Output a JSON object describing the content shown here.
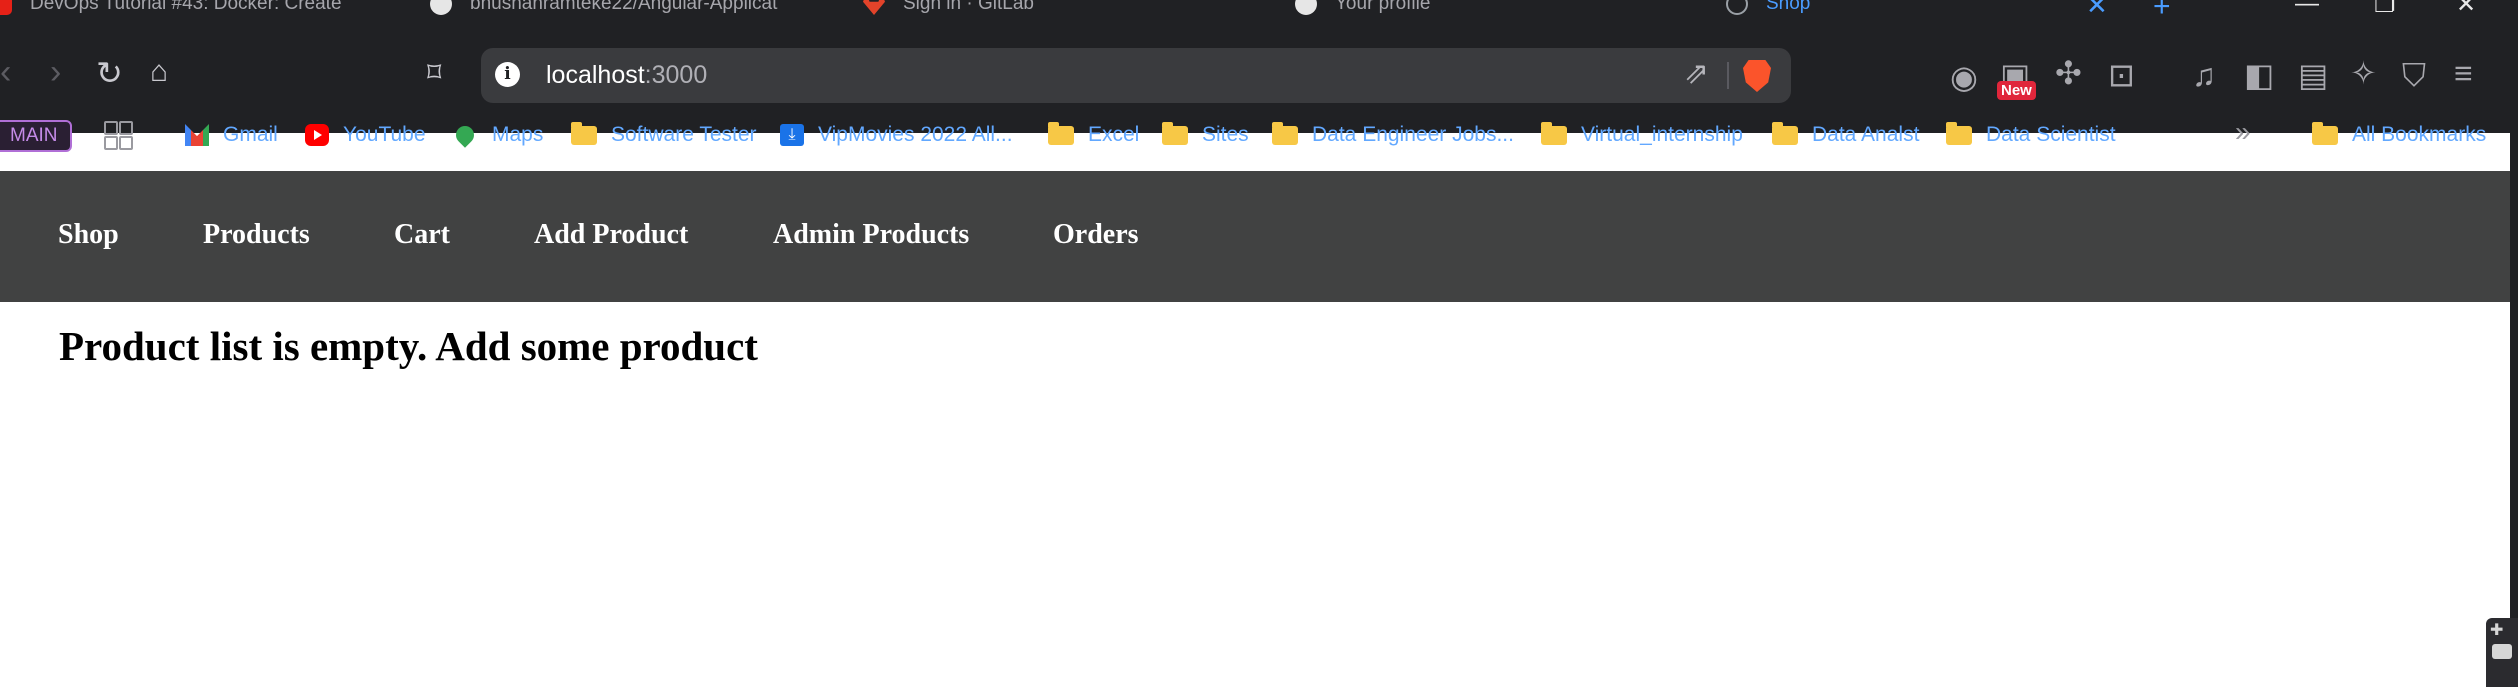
{
  "browser": {
    "tabs": [
      {
        "title": "DevOps Tutorial #43: Docker: Create",
        "icon": "youtube-icon"
      },
      {
        "title": "bhushanramteke22/Angular-Applicat",
        "icon": "github-icon"
      },
      {
        "title": "Sign in · GitLab",
        "icon": "gitlab-icon"
      },
      {
        "title": "Your profile",
        "icon": "github-icon"
      },
      {
        "title": "Shop",
        "icon": "globe-icon",
        "active": true
      }
    ],
    "close_tab_symbol": "✕",
    "new_tab_symbol": "+",
    "window_controls": {
      "minimize": "—",
      "maximize": "❐",
      "close": "✕"
    },
    "address": {
      "host": "localhost",
      "port": ":3000"
    },
    "new_badge": "New",
    "accent_color": "#4a9cff"
  },
  "bookmarks": {
    "profile_badge": "MAIN",
    "items": [
      {
        "label": "Gmail",
        "icon": "gmail-icon"
      },
      {
        "label": "YouTube",
        "icon": "youtube-icon"
      },
      {
        "label": "Maps",
        "icon": "maps-icon"
      },
      {
        "label": "Software Tester",
        "icon": "folder-icon"
      },
      {
        "label": "VipMovies 2022 All...",
        "icon": "download-icon"
      },
      {
        "label": "Excel",
        "icon": "folder-icon"
      },
      {
        "label": "Sites",
        "icon": "folder-icon"
      },
      {
        "label": "Data Engineer Jobs...",
        "icon": "folder-icon"
      },
      {
        "label": "Virtual_internship",
        "icon": "folder-icon"
      },
      {
        "label": "Data Analst",
        "icon": "folder-icon"
      },
      {
        "label": "Data Scientist",
        "icon": "folder-icon"
      }
    ],
    "more": "»",
    "all_bookmarks": "All Bookmarks"
  },
  "site": {
    "nav": [
      "Shop",
      "Products",
      "Cart",
      "Add Product",
      "Admin Products",
      "Orders"
    ],
    "nav_bg_color": "#414242",
    "message": "Product list is empty. Add some product"
  }
}
